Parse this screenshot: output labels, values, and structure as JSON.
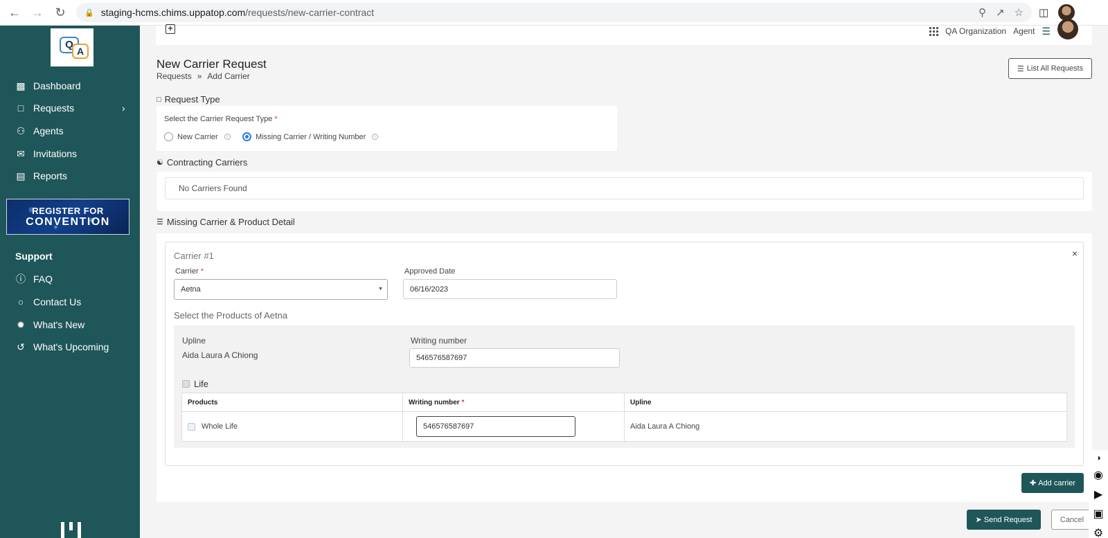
{
  "browser": {
    "url_host": "staging-hcms.chims.uppatop.com",
    "url_path": "/requests/new-carrier-contract"
  },
  "sidebar": {
    "logo_q": "Q",
    "logo_a": "A",
    "items": [
      {
        "label": "Dashboard",
        "icon": "monitor-icon"
      },
      {
        "label": "Requests",
        "icon": "chat-icon"
      },
      {
        "label": "Agents",
        "icon": "users-icon"
      },
      {
        "label": "Invitations",
        "icon": "envelope-icon"
      },
      {
        "label": "Reports",
        "icon": "bar-chart-icon"
      }
    ],
    "banner": {
      "line1": "REGISTER FOR",
      "line2": "CONVENTION"
    },
    "support_heading": "Support",
    "support_items": [
      {
        "label": "FAQ",
        "icon": "question-icon"
      },
      {
        "label": "Contact Us",
        "icon": "chat-bubbles-icon"
      },
      {
        "label": "What's New",
        "icon": "badge-icon"
      },
      {
        "label": "What's Upcoming",
        "icon": "history-icon"
      }
    ]
  },
  "topbar": {
    "org": "QA Organization",
    "role": "Agent"
  },
  "page": {
    "title": "New Carrier Request",
    "breadcrumb": [
      "Requests",
      "»",
      "Add Carrier"
    ],
    "list_all_label": "List All Requests"
  },
  "request_type": {
    "heading": "Request Type",
    "prompt": "Select the Carrier Request Type",
    "required_mark": "*",
    "options": [
      {
        "label": "New Carrier",
        "selected": false
      },
      {
        "label": "Missing Carrier / Writing Number",
        "selected": true
      }
    ]
  },
  "contracting": {
    "heading": "Contracting Carriers",
    "empty_text": "No Carriers Found"
  },
  "missing": {
    "heading": "Missing Carrier & Product Detail",
    "carrier_title": "Carrier #1",
    "close_symbol": "×",
    "carrier_label": "Carrier",
    "required_mark": "*",
    "carrier_value": "Aetna",
    "approved_label": "Approved Date",
    "approved_value": "06/16/2023",
    "products_heading": "Select the Products of Aetna",
    "upline_label": "Upline",
    "upline_value": "Aida Laura A Chiong",
    "writing_label": "Writing number",
    "writing_value": "546576587697",
    "group_label": "Life",
    "table": {
      "headers": [
        "Products",
        "Writing number",
        "Upline"
      ],
      "rows": [
        {
          "product": "Whole Life",
          "writing": "546576587697",
          "upline": "Aida Laura A Chiong"
        }
      ]
    },
    "add_carrier_label": "Add carrier"
  },
  "actions": {
    "send_label": "Send Request",
    "cancel_label": "Cancel"
  },
  "colors": {
    "sidebar": "#1f5659",
    "accent": "#2c7be5",
    "required": "#dd3333"
  }
}
